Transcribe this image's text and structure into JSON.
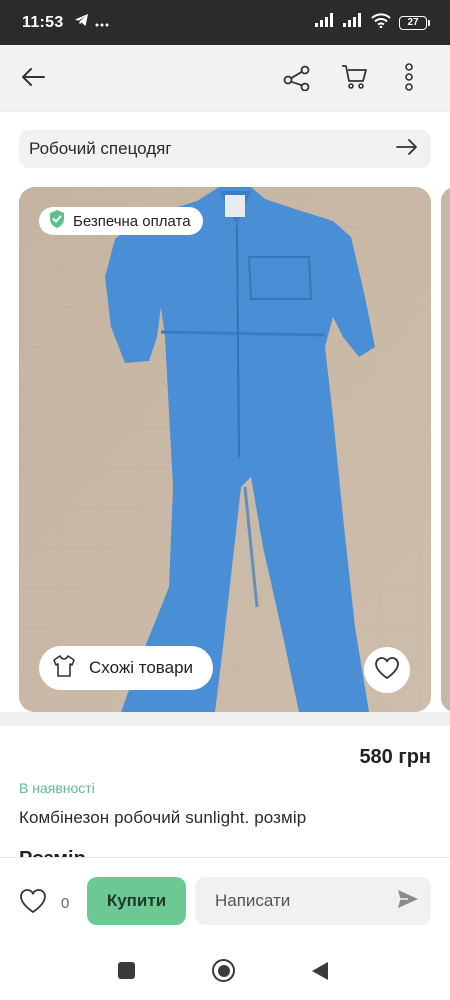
{
  "status_bar": {
    "time": "11:53",
    "battery": "27",
    "icons": [
      "telegram-icon",
      "more-dots-icon",
      "signal-icon",
      "signal-icon",
      "wifi-icon",
      "battery-icon"
    ]
  },
  "app_bar": {
    "icons": [
      "back-arrow-icon",
      "share-icon",
      "cart-icon",
      "more-vertical-icon"
    ]
  },
  "category": {
    "label": "Робочий спецодяг"
  },
  "gallery": {
    "safe_payment_label": "Безпечна оплата",
    "similar_button_label": "Схожі товари"
  },
  "product": {
    "price": "580 грн",
    "availability": "В наявності",
    "title": "Комбінезон робочий sunlight. розмір",
    "cut_heading": "Розмір"
  },
  "action_bar": {
    "like_count": "0",
    "buy_label": "Купити",
    "message_placeholder": "Написати"
  },
  "colors": {
    "accent_green": "#6cc993",
    "stock_green": "#5fbf8a",
    "overall_blue": "#4a8fd6"
  }
}
